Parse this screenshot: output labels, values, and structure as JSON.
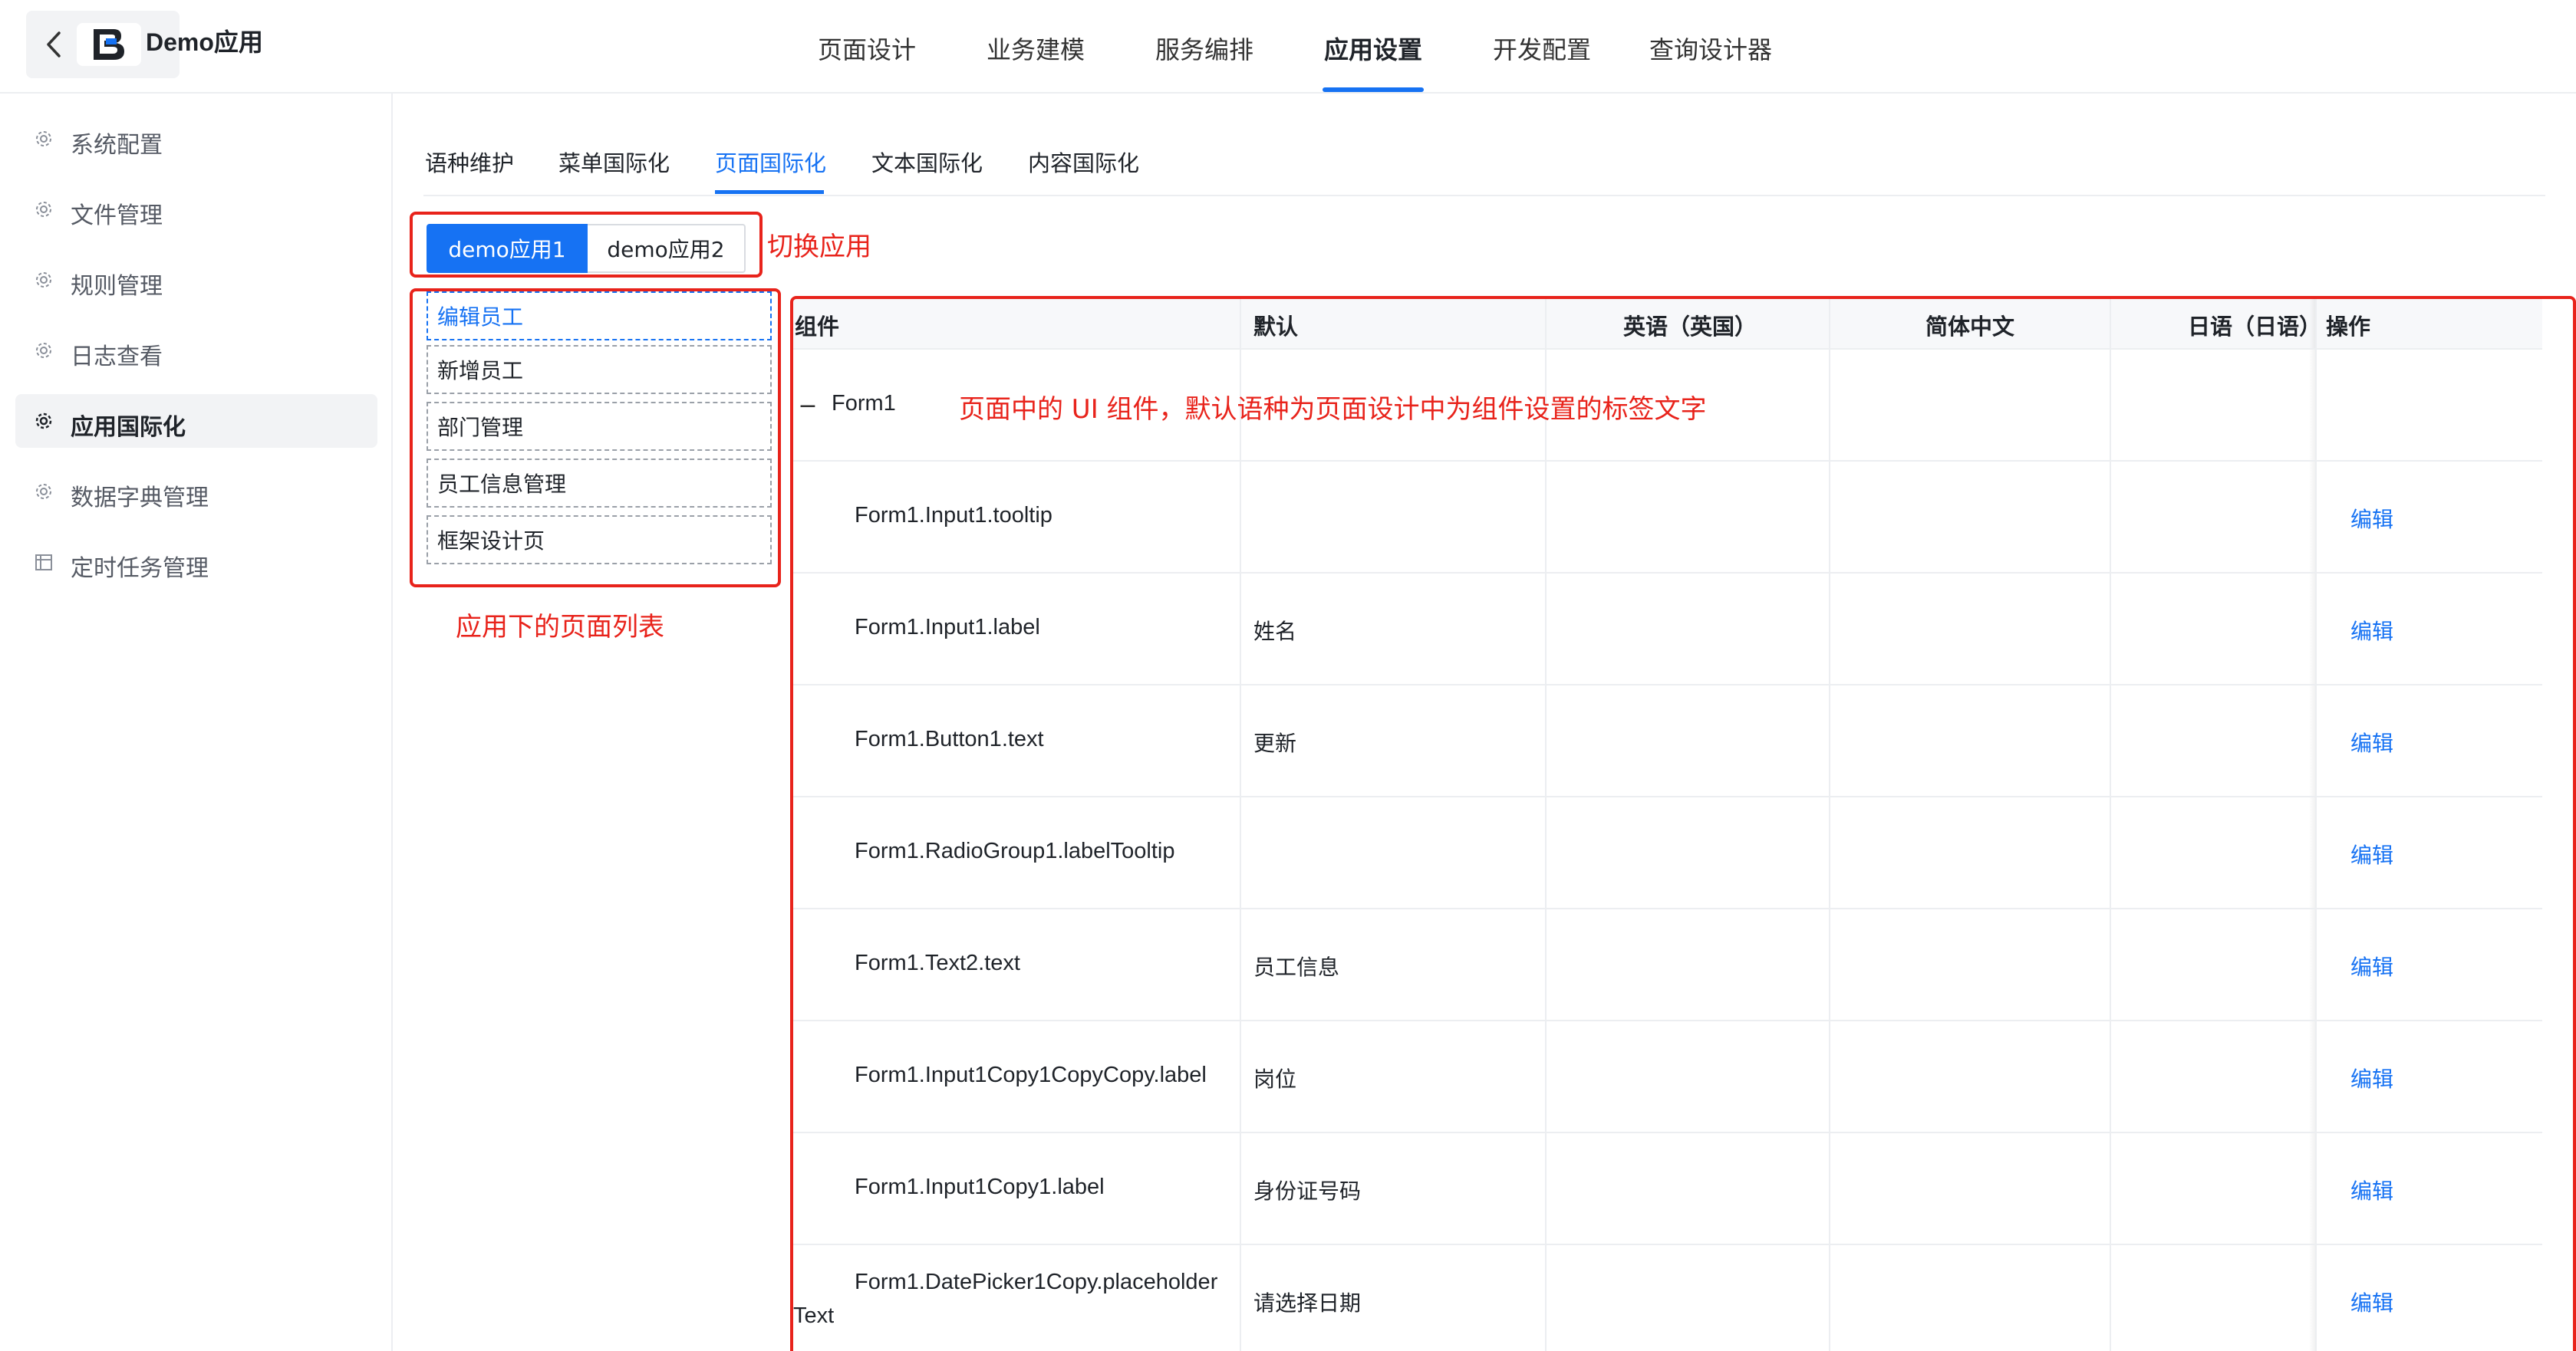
{
  "header": {
    "app_name": "Demo应用",
    "tabs": [
      {
        "label": "页面设计"
      },
      {
        "label": "业务建模"
      },
      {
        "label": "服务编排"
      },
      {
        "label": "应用设置"
      },
      {
        "label": "开发配置"
      },
      {
        "label": "查询设计器"
      }
    ],
    "active_tab": "应用设置"
  },
  "sidebar": {
    "items": [
      {
        "label": "系统配置",
        "icon": "gear-icon"
      },
      {
        "label": "文件管理",
        "icon": "gear-icon"
      },
      {
        "label": "规则管理",
        "icon": "gear-icon"
      },
      {
        "label": "日志查看",
        "icon": "gear-icon"
      },
      {
        "label": "应用国际化",
        "icon": "gear-icon"
      },
      {
        "label": "数据字典管理",
        "icon": "gear-icon"
      },
      {
        "label": "定时任务管理",
        "icon": "calendar-icon"
      }
    ],
    "active_item": "应用国际化"
  },
  "sub_tabs": {
    "items": [
      {
        "label": "语种维护"
      },
      {
        "label": "菜单国际化"
      },
      {
        "label": "页面国际化"
      },
      {
        "label": "文本国际化"
      },
      {
        "label": "内容国际化"
      }
    ],
    "active": "页面国际化"
  },
  "app_switch": {
    "options": [
      "demo应用1",
      "demo应用2"
    ],
    "selected": "demo应用1",
    "annotation": "切换应用"
  },
  "page_list": {
    "items": [
      "编辑员工",
      "新增员工",
      "部门管理",
      "员工信息管理",
      "框架设计页"
    ],
    "selected": "编辑员工",
    "annotation": "应用下的页面列表"
  },
  "table": {
    "annotation": "页面中的 UI 组件，默认语种为页面设计中为组件设置的标签文字",
    "columns": [
      "组件",
      "默认",
      "英语（英国）",
      "简体中文",
      "日语（日语）",
      "操作"
    ],
    "group": {
      "name": "Form1",
      "toggle": "−"
    },
    "rows": [
      {
        "component": "Form1.Input1.tooltip",
        "default": "",
        "action": "编辑"
      },
      {
        "component": "Form1.Input1.label",
        "default": "姓名",
        "action": "编辑"
      },
      {
        "component": "Form1.Button1.text",
        "default": "更新",
        "action": "编辑"
      },
      {
        "component": "Form1.RadioGroup1.labelTooltip",
        "default": "",
        "action": "编辑"
      },
      {
        "component": "Form1.Text2.text",
        "default": "员工信息",
        "action": "编辑"
      },
      {
        "component": "Form1.Input1Copy1CopyCopy.label",
        "default": "岗位",
        "action": "编辑"
      },
      {
        "component": "Form1.Input1Copy1.label",
        "default": "身份证号码",
        "action": "编辑"
      },
      {
        "component_line1": "Form1.DatePicker1Copy.placeholder",
        "component_line2": "Text",
        "default": "请选择日期",
        "action": "编辑"
      }
    ]
  },
  "colors": {
    "accent": "#1672f3",
    "annotation_red": "#e8231b",
    "active_bg": "#f2f3f5"
  }
}
